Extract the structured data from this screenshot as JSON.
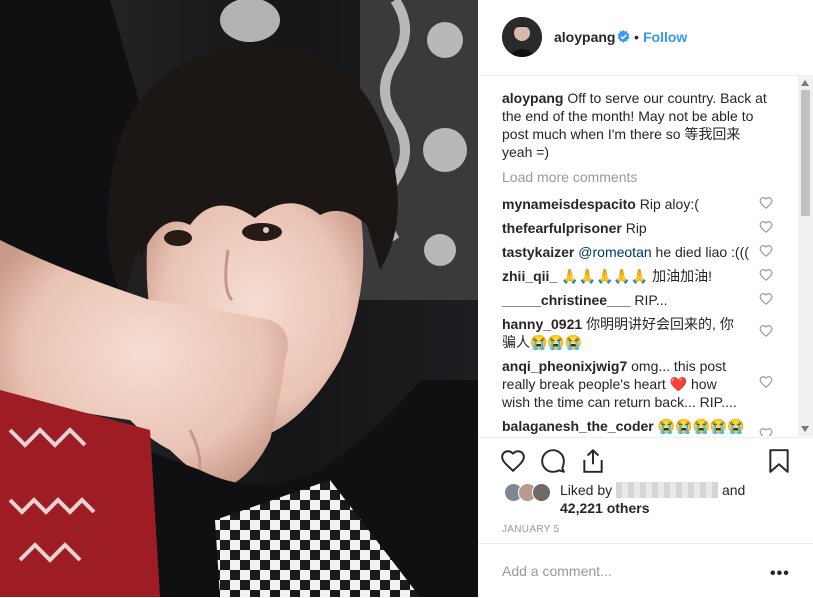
{
  "post": {
    "username": "aloypang",
    "follow_label": "Follow",
    "separator": "•",
    "caption_text": "Off to serve our country. Back at the end of the month! May not be able to post much when I'm there so 等我回来 yeah =)",
    "load_more_label": "Load more comments",
    "date": "JANUARY 5",
    "photo_icon": "selfie-photo"
  },
  "comments": [
    {
      "user": "mynameisdespacito",
      "text": "Rip aloy:("
    },
    {
      "user": "thefearfulprisoner",
      "text": "Rip"
    },
    {
      "user": "tastykaizer",
      "mention": "@romeotan",
      "text": "he died liao :((("
    },
    {
      "user": "zhii_qii_",
      "text": "🙏🙏🙏🙏🙏 加油加油!"
    },
    {
      "user": "_____christinee___",
      "text": "RIP..."
    },
    {
      "user": "hanny_0921",
      "text": "你明明讲好会回来的, 你骗人😭😭😭"
    },
    {
      "user": "anqi_pheonixjwig7",
      "text_a": "omg... this post really break people's heart",
      "emoji": "❤️",
      "text_b": "how wish the time can return back... RIP...."
    },
    {
      "user": "balaganesh_the_coder",
      "text": "😭😭😭😭😭"
    }
  ],
  "likes": {
    "liked_by_label": "Liked by",
    "and_label": "and",
    "others_label": "42,221 others"
  },
  "add_comment": {
    "placeholder": "Add a comment..."
  },
  "more_options": "•••",
  "colors": {
    "follow_blue": "#3897f0",
    "verified_blue": "#3897f0",
    "muted_text": "#999999",
    "text": "#262626",
    "heart_red": "#ed4956"
  },
  "icons": [
    "heart-icon",
    "comment-icon",
    "share-icon",
    "bookmark-icon",
    "verified-badge-icon",
    "more-options-icon"
  ]
}
